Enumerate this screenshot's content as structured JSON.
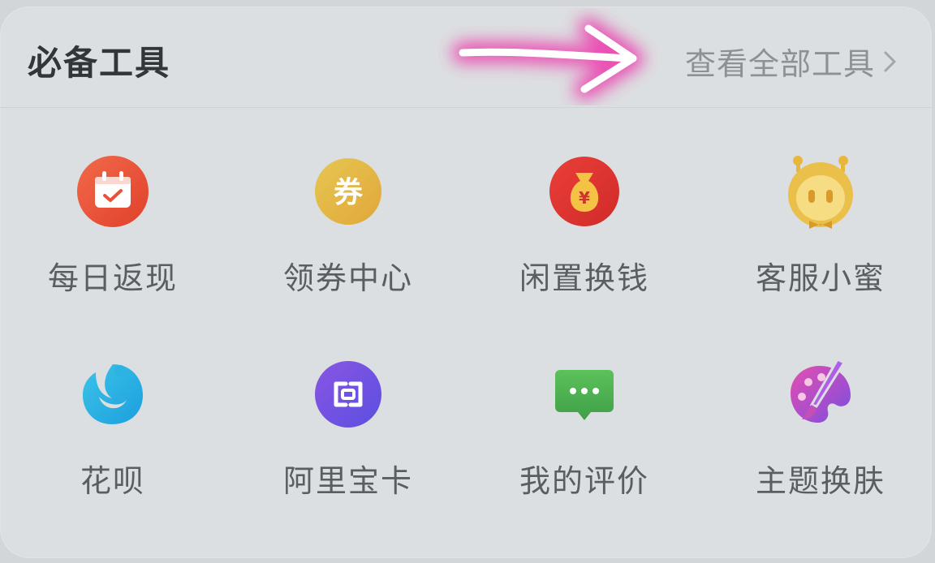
{
  "header": {
    "title": "必备工具",
    "view_all": "查看全部工具"
  },
  "tools": [
    {
      "label": "每日返现",
      "icon": "calendar-check-icon"
    },
    {
      "label": "领券中心",
      "icon": "coupon-icon"
    },
    {
      "label": "闲置换钱",
      "icon": "money-bag-icon"
    },
    {
      "label": "客服小蜜",
      "icon": "assistant-mascot-icon"
    },
    {
      "label": "花呗",
      "icon": "huabei-icon"
    },
    {
      "label": "阿里宝卡",
      "icon": "sim-card-icon"
    },
    {
      "label": "我的评价",
      "icon": "message-bubble-icon"
    },
    {
      "label": "主题换肤",
      "icon": "palette-icon"
    }
  ],
  "icon_text": {
    "coupon": "券",
    "yen": "¥"
  },
  "colors": {
    "annotation_arrow": "#ec3fae"
  }
}
